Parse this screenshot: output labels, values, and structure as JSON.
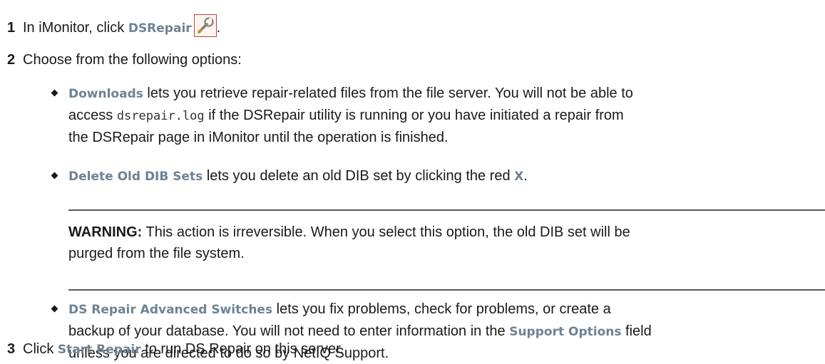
{
  "steps": [
    {
      "number": "1",
      "pre": "In iMonitor, click ",
      "ui_label": "DSRepair",
      "post": ".",
      "icon": "wrench-tool-icon"
    },
    {
      "number": "2",
      "text": "Choose from the following options:"
    },
    {
      "number": "3",
      "pre": "Click ",
      "ui_label": "Start Repair",
      "post": " to run DS Repair on this server."
    }
  ],
  "options": [
    {
      "label": "Downloads",
      "line1_rest": " lets you retrieve repair-related files from the file server. You will not be able to",
      "line2_pre": "access ",
      "line2_code": "dsrepair.log",
      "line2_post": " if the DSRepair utility is running or you have initiated a repair from",
      "line3": "the DSRepair page in iMonitor until the operation is finished."
    },
    {
      "label": "Delete Old DIB Sets",
      "rest": " lets you delete an old DIB set by clicking the red ",
      "x_label": "X",
      "end": "."
    },
    {
      "label": "DS Repair Advanced Switches",
      "line1_rest": " lets you fix problems, check for problems, or create a",
      "line2_pre": "backup of your database. You will not need to enter information in the ",
      "line2_ui": "Support Options",
      "line2_post": " field",
      "line3": "unless you are directed to do so by NetIQ Support."
    }
  ],
  "warning": {
    "label": "WARNING:",
    "line1": " This action is irreversible. When you select this option, the old DIB set will be",
    "line2": "purged from the file system."
  },
  "colors": {
    "ui_label": "#6e8294",
    "text": "#1a1a1a",
    "rule": "#5a5a5a"
  }
}
